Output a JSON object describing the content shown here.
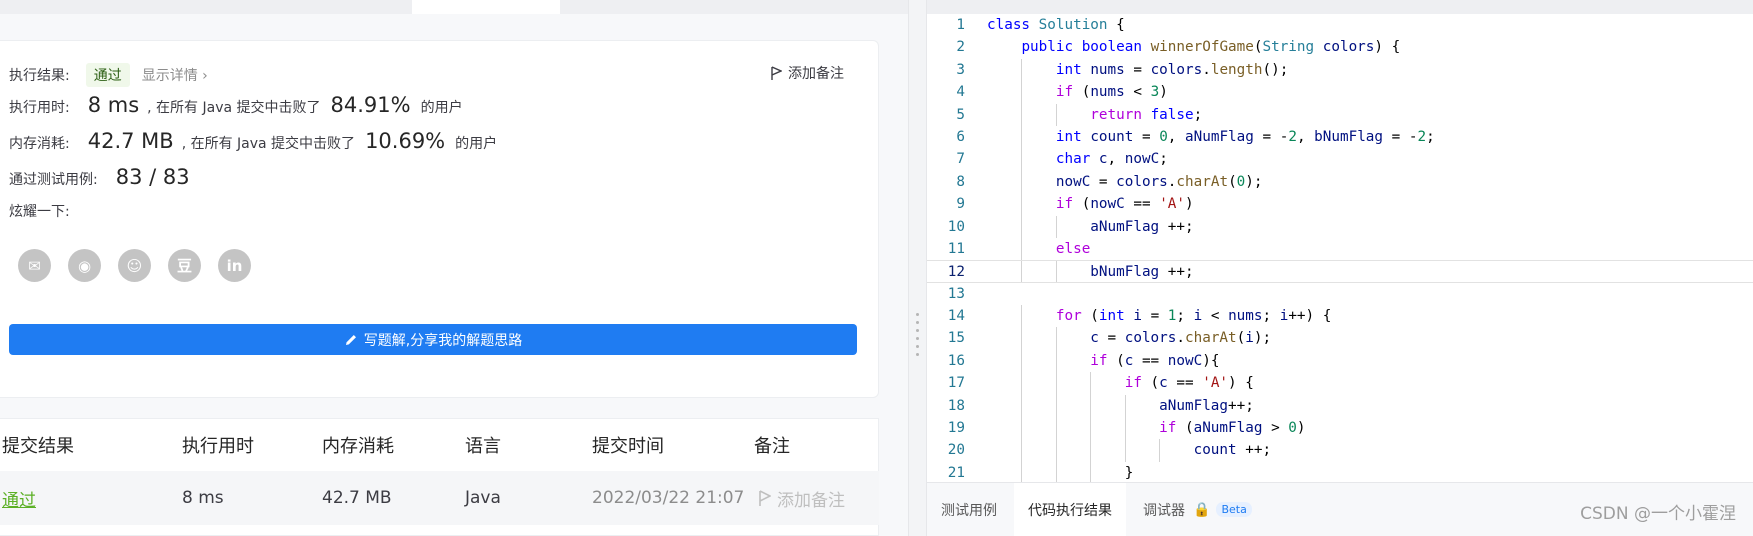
{
  "result": {
    "status_label": "执行结果:",
    "status_value": "通过",
    "details_link": "显示详情 ›",
    "add_note": "添加备注",
    "runtime_label": "执行用时:",
    "runtime_value": "8 ms",
    "runtime_text": ", 在所有 Java 提交中击败了",
    "runtime_pct": "84.91%",
    "users_suffix": "的用户",
    "memory_label": "内存消耗:",
    "memory_value": "42.7 MB",
    "memory_text": ", 在所有 Java 提交中击败了",
    "memory_pct": "10.69%",
    "tests_label": "通过测试用例:",
    "tests_value": "83 / 83",
    "share_label": "炫耀一下:",
    "share_icons": [
      "wechat-icon",
      "weibo-icon",
      "qq-icon",
      "douban-icon",
      "linkedin-icon"
    ],
    "share_glyphs": [
      "✉",
      "◉",
      "☺",
      "豆",
      "in"
    ],
    "write_button": "写题解,分享我的解题思路"
  },
  "submissions": {
    "headers": [
      "提交结果",
      "执行用时",
      "内存消耗",
      "语言",
      "提交时间",
      "备注"
    ],
    "rows": [
      {
        "result": "通过",
        "runtime": "8 ms",
        "memory": "42.7 MB",
        "language": "Java",
        "time": "2022/03/22 21:07",
        "note": "添加备注"
      }
    ]
  },
  "editor": {
    "current_line": 12,
    "lines": [
      "class Solution {",
      "    public boolean winnerOfGame(String colors) {",
      "        int nums = colors.length();",
      "        if (nums < 3)",
      "            return false;",
      "        int count = 0, aNumFlag = -2, bNumFlag = -2;",
      "        char c, nowC;",
      "        nowC = colors.charAt(0);",
      "        if (nowC == 'A')",
      "            aNumFlag ++;",
      "        else",
      "            bNumFlag ++;",
      "",
      "        for (int i = 1; i < nums; i++) {",
      "            c = colors.charAt(i);",
      "            if (c == nowC){",
      "                if (c == 'A') {",
      "                    aNumFlag++;",
      "                    if (aNumFlag > 0)",
      "                        count ++;",
      "                }"
    ]
  },
  "bottom_tabs": {
    "test_cases": "测试用例",
    "run_result": "代码执行结果",
    "debugger": "调试器",
    "beta": "Beta"
  },
  "watermark": "CSDN @一个小霍涅",
  "colors": {
    "accent": "#1f7cf2",
    "pass_green": "#5cb026"
  }
}
